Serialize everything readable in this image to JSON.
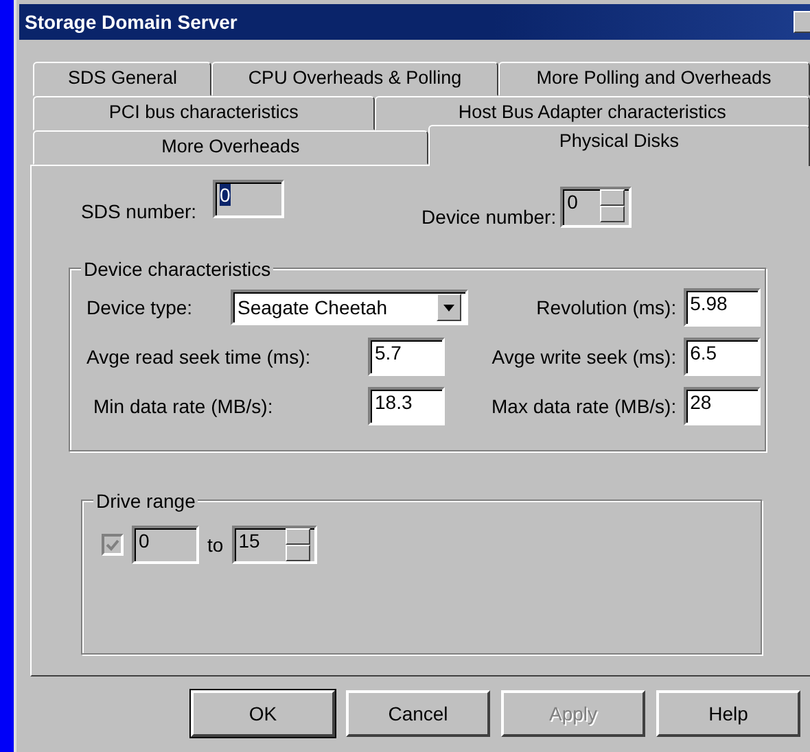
{
  "window": {
    "title": "Storage Domain Server"
  },
  "tabs": [
    [
      {
        "label": "SDS General",
        "selected": false
      },
      {
        "label": "CPU Overheads & Polling",
        "selected": false
      },
      {
        "label": "More Polling and Overheads",
        "selected": false
      }
    ],
    [
      {
        "label": "PCI bus characteristics",
        "selected": false
      },
      {
        "label": "Host Bus Adapter characteristics",
        "selected": false
      }
    ],
    [
      {
        "label": "More Overheads",
        "selected": false
      },
      {
        "label": "Physical Disks",
        "selected": true
      }
    ]
  ],
  "sds_number": {
    "label": "SDS number:",
    "value": "0",
    "disabled": true
  },
  "device_number": {
    "label": "Device number:",
    "value": "0",
    "disabled": true
  },
  "device_characteristics": {
    "title": "Device characteristics",
    "device_type": {
      "label": "Device type:",
      "value": "Seagate Cheetah"
    },
    "fields": [
      {
        "label": "Revolution (ms):",
        "value": "5.98"
      },
      {
        "label": "Avge read seek time (ms):",
        "value": "5.7"
      },
      {
        "label": "Avge write seek (ms):",
        "value": "6.5"
      },
      {
        "label": "Min data rate (MB/s):",
        "value": "18.3"
      },
      {
        "label": "Max data rate (MB/s):",
        "value": "28"
      }
    ]
  },
  "drive_range": {
    "title": "Drive range",
    "checked": true,
    "disabled": true,
    "from": "0",
    "to_label": "to",
    "to": "15"
  },
  "buttons": [
    {
      "label": "OK",
      "default": true,
      "disabled": false
    },
    {
      "label": "Cancel",
      "default": false,
      "disabled": false
    },
    {
      "label": "Apply",
      "default": false,
      "disabled": true
    },
    {
      "label": "Help",
      "default": false,
      "disabled": false
    }
  ]
}
